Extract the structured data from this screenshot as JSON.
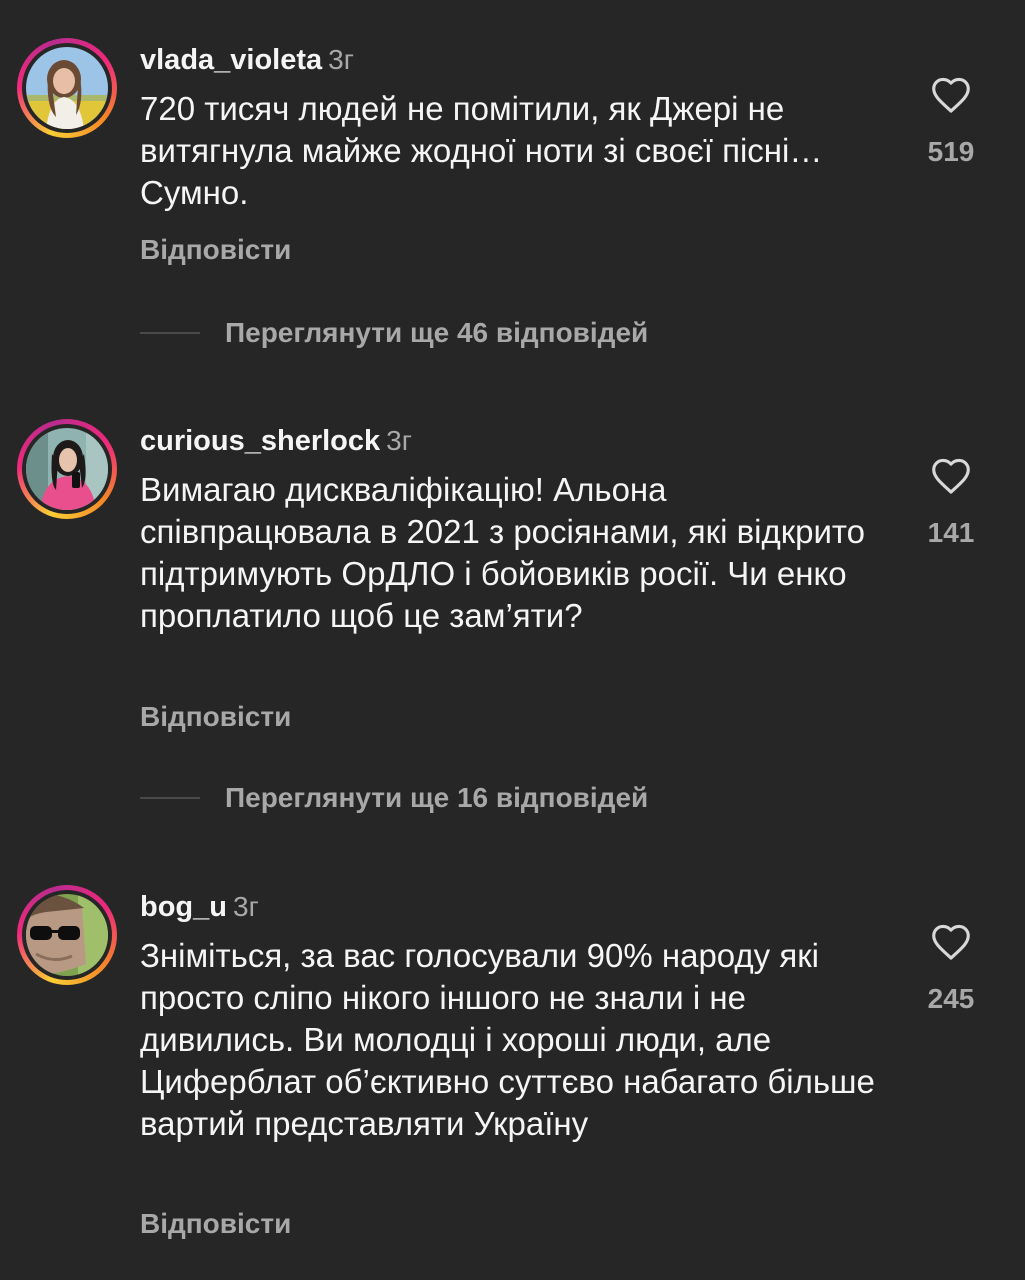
{
  "comments": [
    {
      "username": "vlada_violeta",
      "time": "3г",
      "text": "720 тисяч людей не помітили, як Джері не витягнула майже жодної ноти зі своєї пісні… Сумно.",
      "likes": "519",
      "reply_label": "Відповісти",
      "more_replies": "Переглянути ще 46 відповідей"
    },
    {
      "username": "curious_sherlock",
      "time": "3г",
      "text": "Вимагаю дискваліфікацію! Альона співпрацювала в 2021 з росіянами, які відкрито підтримують ОрДЛО і бойовиків росії. Чи енко проплатило щоб це зам’яти?",
      "likes": "141",
      "reply_label": "Відповісти",
      "more_replies": "Переглянути ще 16 відповідей"
    },
    {
      "username": "bog_u",
      "time": "3г",
      "text": "Зніміться, за вас голосували 90% народу які просто сліпо нікого іншого не знали і не дивились. Ви молодці і хороші люди, але Циферблат об’єктивно суттєво набагато більше вартий представляти Україну",
      "likes": "245",
      "reply_label": "Відповісти"
    }
  ],
  "icons": {
    "like": "heart-outline-icon"
  },
  "colors": {
    "background": "#262626",
    "primary_text": "#f5f5f5",
    "secondary_text": "#a8a8a8"
  }
}
